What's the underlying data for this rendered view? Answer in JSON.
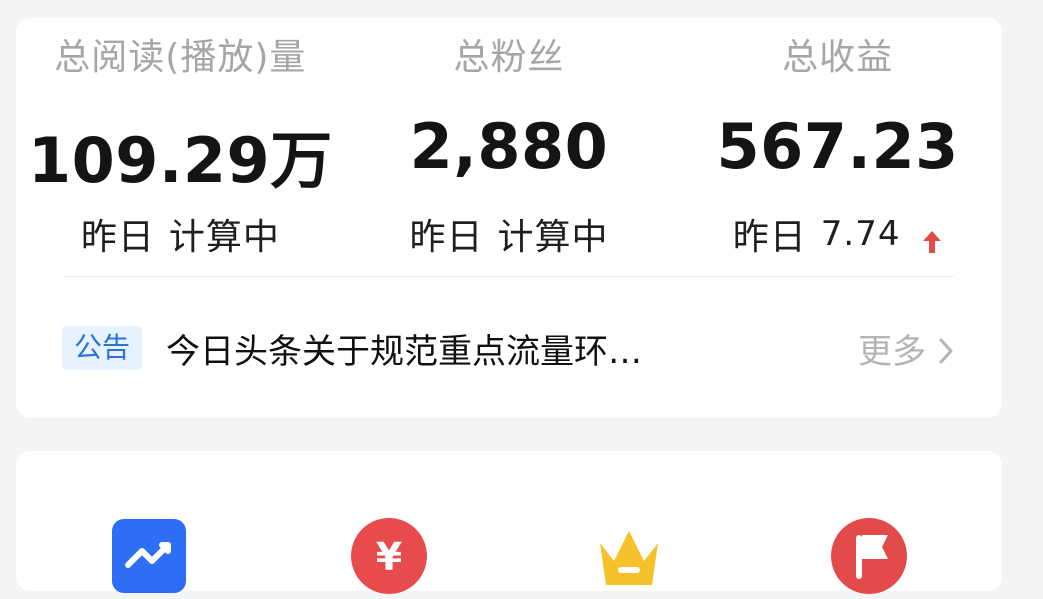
{
  "stats": [
    {
      "label": "总阅读(播放)量",
      "value": "109.29万",
      "sub_label": "昨日",
      "sub_value": "计算中",
      "trend": ""
    },
    {
      "label": "总粉丝",
      "value": "2,880",
      "sub_label": "昨日",
      "sub_value": "计算中",
      "trend": ""
    },
    {
      "label": "总收益",
      "value": "567.23",
      "sub_label": "昨日",
      "sub_value": "7.74",
      "trend": "up"
    }
  ],
  "notice": {
    "badge": "公告",
    "text": "今日头条关于规范重点流量环…",
    "more": "更多"
  },
  "icons": [
    {
      "name": "trend-chart-icon",
      "color": "#2e6df6"
    },
    {
      "name": "yuan-icon",
      "color": "#e84b4b"
    },
    {
      "name": "crown-icon",
      "color": "#f6c22b"
    },
    {
      "name": "flag-icon",
      "color": "#e34b4b"
    }
  ],
  "colors": {
    "label_gray": "#a6a6a6",
    "badge_bg": "#e7f2ff",
    "badge_text": "#2f73d9",
    "up_arrow": "#e34b4b"
  }
}
